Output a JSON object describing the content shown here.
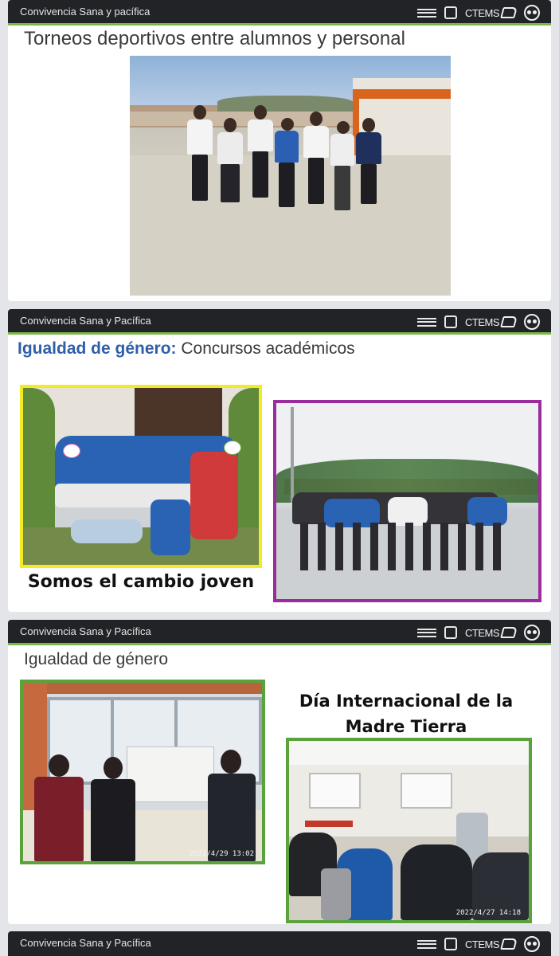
{
  "slides": [
    {
      "header": "Convivencia Sana y pacífica",
      "title": "Torneos deportivos entre alumnos y personal"
    },
    {
      "header": "Convivencia Sana y Pacífica",
      "title_accent": "Igualdad de género:",
      "title_rest": " Concursos académicos",
      "caption": "Somos el cambio joven"
    },
    {
      "header": "Convivencia Sana y Pacífica",
      "title": "Igualdad de género",
      "caption_line1": "Día Internacional de la",
      "caption_line2": "Madre Tierra",
      "stamp_left": "2022/4/29 13:02",
      "stamp_right": "2022/4/27 14:18"
    },
    {
      "header": "Convivencia Sana y Pacífica"
    }
  ],
  "logos": {
    "ctems": "CTEMS"
  },
  "colors": {
    "header_bg": "#222327",
    "header_accent": "#7ab648",
    "title_accent": "#2f5fa8",
    "frame_yellow": "#f2ea22",
    "frame_purple": "#9b2c9b",
    "frame_green": "#5aa33c"
  }
}
